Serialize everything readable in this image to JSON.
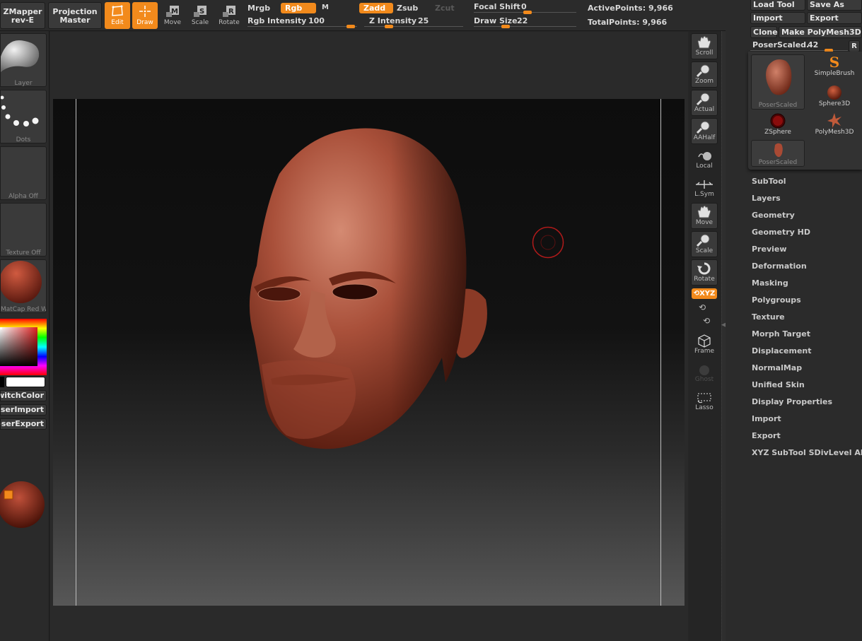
{
  "toolbar": {
    "zmapper": {
      "line1": "ZMapper",
      "line2": "rev-E"
    },
    "projection_master": {
      "line1": "Projection",
      "line2": "Master"
    },
    "modes": [
      {
        "key": "edit",
        "label": "Edit",
        "active": true
      },
      {
        "key": "draw",
        "label": "Draw",
        "active": true
      },
      {
        "key": "move",
        "label": "Move",
        "active": false
      },
      {
        "key": "scale",
        "label": "Scale",
        "active": false
      },
      {
        "key": "rotate",
        "label": "Rotate",
        "active": false
      }
    ],
    "mrgb": "Mrgb",
    "rgb": "Rgb",
    "m": "M",
    "rgb_intensity": {
      "label": "Rgb  Intensity",
      "value": "100",
      "level": 1.0
    },
    "zadd": "Zadd",
    "zsub": "Zsub",
    "zcut": "Zcut",
    "z_intensity": {
      "label": "Z  Intensity",
      "value": "25",
      "level": 0.25
    },
    "focal_shift": {
      "label": "Focal  Shift",
      "value": "0",
      "level": 0.5
    },
    "draw_size": {
      "label": "Draw  Size",
      "value": "22",
      "level": 0.14
    },
    "active_points": {
      "label": "ActivePoints:",
      "value": "9,966"
    },
    "total_points": {
      "label": "TotalPoints:",
      "value": "9,966"
    }
  },
  "left_shelf": {
    "thumbs": [
      {
        "key": "material",
        "caption": "Layer"
      },
      {
        "key": "stroke",
        "caption": "Dots"
      },
      {
        "key": "alpha",
        "caption": "Alpha  Off"
      },
      {
        "key": "texture",
        "caption": "Texture  Off"
      },
      {
        "key": "matcap",
        "caption": "MatCap  Red  Wax"
      }
    ],
    "buttons": [
      {
        "key": "switch-color",
        "label": "SwitchColor"
      },
      {
        "key": "poser-import",
        "label": "PoserImport"
      },
      {
        "key": "poser-export",
        "label": "PoserExport"
      }
    ],
    "colors": {
      "main": "#ffffff",
      "secondary": "#000000",
      "accent": "#f28a1c"
    }
  },
  "right_shelf": [
    {
      "key": "scroll",
      "label": "Scroll",
      "icon": "hand-icon"
    },
    {
      "key": "zoom",
      "label": "Zoom",
      "icon": "magnifier-icon"
    },
    {
      "key": "actual",
      "label": "Actual",
      "icon": "magnifier-icon"
    },
    {
      "key": "aahalf",
      "label": "AAHalf",
      "icon": "magnifier-icon"
    },
    {
      "key": "local",
      "label": "Local",
      "icon": "local-icon"
    },
    {
      "key": "lsym",
      "label": "L.Sym",
      "icon": "symmetry-icon"
    },
    {
      "key": "move",
      "label": "Move",
      "icon": "hand-icon"
    },
    {
      "key": "scale",
      "label": "Scale",
      "icon": "magnifier-icon"
    },
    {
      "key": "rotate",
      "label": "Rotate",
      "icon": "rotate-icon"
    },
    {
      "key": "xyz",
      "label": "XYZ",
      "icon": "xyz-icon",
      "active": true
    },
    {
      "key": "frame",
      "label": "Frame",
      "icon": "cube-icon"
    },
    {
      "key": "ghost",
      "label": "Ghost",
      "icon": "sphere-icon"
    },
    {
      "key": "lasso",
      "label": "Lasso",
      "icon": "lasso-icon"
    }
  ],
  "tool_panel": {
    "load_tool": "Load Tool",
    "save_as": "Save As",
    "import": "Import",
    "export": "Export",
    "clone": "Clone",
    "make_polymesh": "Make PolyMesh3D",
    "current_tool": {
      "label": "PoserScaled.",
      "value": "42"
    },
    "r": "R",
    "tools": [
      {
        "key": "poserscaled-large",
        "label": "PoserScaled"
      },
      {
        "key": "simplebrush",
        "label": "SimpleBrush"
      },
      {
        "key": "sphere3d",
        "label": "Sphere3D"
      },
      {
        "key": "zsphere",
        "label": "ZSphere"
      },
      {
        "key": "polymesh3d",
        "label": "PolyMesh3D"
      },
      {
        "key": "poserscaled-small",
        "label": "PoserScaled"
      }
    ],
    "menu": [
      "SubTool",
      "Layers",
      "Geometry",
      "Geometry HD",
      "Preview",
      "Deformation",
      "Masking",
      "Polygroups",
      "Texture",
      "Morph Target",
      "Displacement",
      "NormalMap",
      "Unified Skin",
      "Display Properties",
      "Import",
      "Export",
      "XYZ  SubTool  SDivLevel  All"
    ]
  }
}
